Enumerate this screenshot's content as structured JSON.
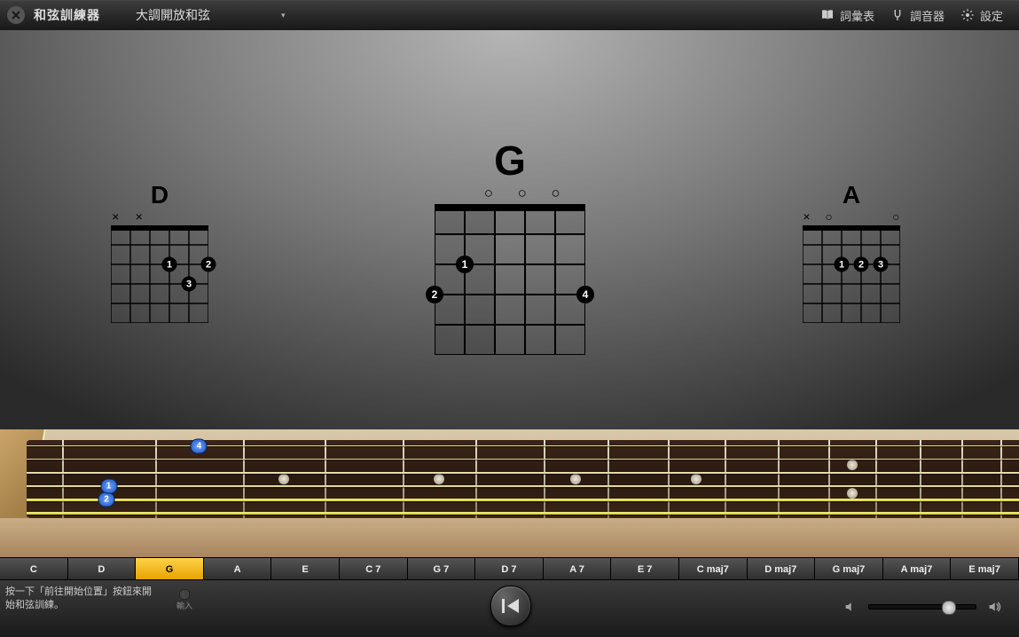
{
  "header": {
    "title": "和弦訓練器",
    "lesson_select": "大調開放和弦",
    "glossary": "詞彙表",
    "tuner": "調音器",
    "setup": "設定"
  },
  "chords": {
    "left": {
      "name": "D",
      "marks": [
        "×",
        "×",
        "",
        "",
        "",
        ""
      ]
    },
    "center": {
      "name": "G",
      "marks": [
        "",
        "",
        "○",
        "○",
        "○",
        ""
      ]
    },
    "right": {
      "name": "A",
      "marks": [
        "×",
        "○",
        "",
        "",
        "",
        "○"
      ]
    }
  },
  "fretboard": {
    "finger_1": "1",
    "finger_2": "2",
    "finger_4": "4"
  },
  "chord_list": [
    "C",
    "D",
    "G",
    "A",
    "E",
    "C 7",
    "G 7",
    "D 7",
    "A 7",
    "E 7",
    "C maj7",
    "D maj7",
    "G maj7",
    "A maj7",
    "E maj7"
  ],
  "selected_chord_index": 2,
  "footer": {
    "hint": "按一下「前往開始位置」按鈕來開始和弦訓練。",
    "input_label": "輸入"
  }
}
